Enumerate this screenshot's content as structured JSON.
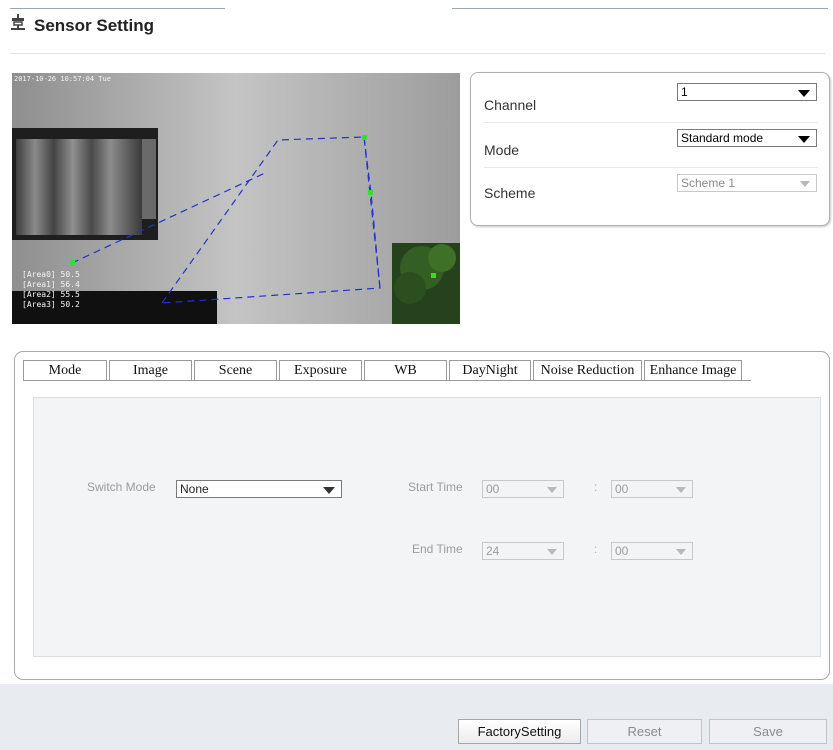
{
  "header": {
    "title": "Sensor Setting",
    "icon": "sensor-icon"
  },
  "video": {
    "timestamp": "2017-10-26 10:57:04 Tue",
    "area_labels": [
      "[Area0] 50.5",
      "[Area1] 56.4",
      "[Area2] 55.5",
      "[Area3] 50.2"
    ]
  },
  "settings": {
    "channel_label": "Channel",
    "channel_value": "1",
    "mode_label": "Mode",
    "mode_value": "Standard mode",
    "scheme_label": "Scheme",
    "scheme_value": "Scheme 1"
  },
  "tabs": [
    "Mode",
    "Image",
    "Scene",
    "Exposure",
    "WB",
    "DayNight",
    "Noise Reduction",
    "Enhance Image"
  ],
  "mode_tab": {
    "switch_mode_label": "Switch Mode",
    "switch_mode_value": "None",
    "start_time_label": "Start Time",
    "start_hour": "00",
    "start_minute": "00",
    "end_time_label": "End Time",
    "end_hour": "24",
    "end_minute": "00",
    "colon": ":"
  },
  "buttons": {
    "factory": "FactorySetting",
    "reset": "Reset",
    "save": "Save"
  },
  "colors": {
    "overlay_line": "#2233cc",
    "marker": "#33dd33",
    "panel_border": "#b0b0b0",
    "footer_bg": "#e8ebf0"
  }
}
